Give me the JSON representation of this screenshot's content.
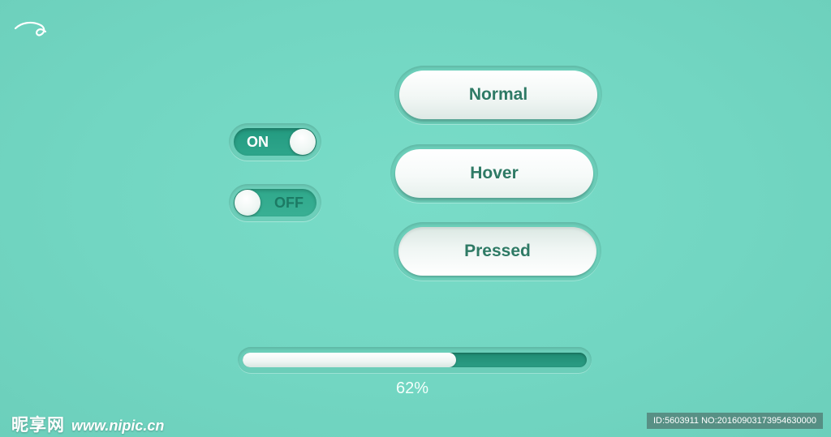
{
  "logo": {
    "icon": "squiggle-logo-icon"
  },
  "toggles": {
    "on": {
      "label": "ON",
      "state": true
    },
    "off": {
      "label": "OFF",
      "state": false
    }
  },
  "buttons": {
    "normal": {
      "label": "Normal"
    },
    "hover": {
      "label": "Hover"
    },
    "pressed": {
      "label": "Pressed"
    }
  },
  "progress": {
    "value": 62,
    "text": "62%"
  },
  "watermark": {
    "brand": "昵享网",
    "url": "www.nipic.cn",
    "id_text": "ID:5603911 NO:20160903173954630000"
  },
  "colors": {
    "background": "#72d6c2",
    "accent_dark": "#2a9a80",
    "button_text": "#2e7a65"
  }
}
